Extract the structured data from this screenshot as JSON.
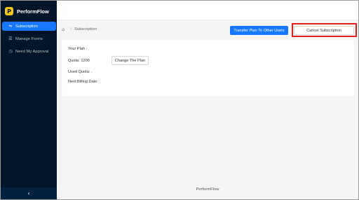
{
  "brand": {
    "logo_letter": "P",
    "name": "PerformFlow"
  },
  "sidebar": {
    "items": [
      {
        "label": "Subscription",
        "icon": "subscription-icon",
        "active": true
      },
      {
        "label": "Manage Forms",
        "icon": "list-icon",
        "active": false
      },
      {
        "label": "Need My Approval",
        "icon": "clock-icon",
        "active": false
      }
    ],
    "collapse_glyph": "‹"
  },
  "breadcrumb": {
    "current": "Subscription",
    "separator": "/"
  },
  "actions": {
    "transfer_label": "Transfer Plan To Other Users",
    "cancel_label": "Cancel Subscription"
  },
  "plan": {
    "your_plan_label": "Your Plan :",
    "quota_label": "Quota: 1200",
    "change_plan_label": "Change The Plan",
    "used_quota_label": "Used Quota: .",
    "next_billing_label": "Next Billing Date:"
  },
  "footer": {
    "text": "PerformFlow"
  },
  "colors": {
    "sidebar_bg": "#001529",
    "accent": "#1677ff",
    "highlight": "#e0201a",
    "logo": "#f5c518"
  }
}
